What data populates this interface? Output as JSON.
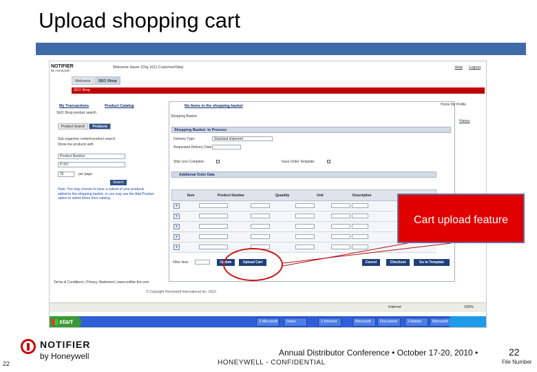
{
  "slide": {
    "title": "Upload shopping cart",
    "callout_label": "Cart upload feature",
    "accent_color": "#3e6aa8",
    "callout_color": "#e00000",
    "circle_color": "#cc1111"
  },
  "screenshot": {
    "logo": "NOTIFIER",
    "logo_sub": "By Honeywell",
    "welcome": "Welcome Haver (Org 101) Customer/Step",
    "top_links": [
      "Help",
      "Logout"
    ],
    "tabs": [
      "Welcome",
      "SEO Shop"
    ],
    "red_bar": "SEO Shop",
    "left": {
      "my_transactions": "My Transactions",
      "product_catalog": "Product Catalog",
      "breadcrumb": "SEO Shop product search",
      "subtabs": [
        "Product Search",
        "Products"
      ],
      "search_help_1": "Sub organizer content product search",
      "search_help_2": "Show me products with",
      "select_value": "Product Number",
      "input_value": "P-SH",
      "page_select": "25",
      "page_label": "per page",
      "search_button": "Search",
      "help_text": "Note: You may choose to have a subset of your products added to the shopping basket, or you may use the Add Product option to select items from catalog."
    },
    "main": {
      "no_items_link": "No Items in the shopping basket",
      "sub": "Shopping Basket",
      "home_profile": "Home  My Profile",
      "history": "History",
      "basket_header": "Shopping Basket: In Process",
      "delivery_type_label": "Delivery Type:",
      "delivery_type_value": "Standard shipment",
      "req_delivery_label": "Requested Delivery Date:",
      "ship_complete_label": "Ship Line Complete:",
      "save_template_label": "Save Order Template:",
      "additional_header": "Additional Order Data",
      "columns": [
        "Item",
        "Product Number",
        "Quantity",
        "Unit",
        "Description"
      ],
      "row_count_display": 5,
      "filter_label": "Filter lines",
      "buttons": [
        "Update",
        "Upload Cart",
        "Cancel",
        "Checkout",
        "Go to Template"
      ]
    },
    "footer_links": "Terms & Conditions | Privacy Statement | www.notifier-fire.com",
    "copyright": "© Copyright Honeywell International Inc. 2010",
    "status_zone": "Internet",
    "zoom": "100%",
    "taskbar": {
      "start": "start",
      "items": [
        "3 Microsoft",
        "Inbox",
        "2 Internet",
        "Microsoft",
        "Document",
        "2 Adobe",
        "Microsoft"
      ]
    }
  },
  "footer": {
    "brand": "NOTIFIER",
    "brand_sub": "by Honeywell",
    "slide_number_left": "22",
    "confidential": "HONEYWELL - CONFIDENTIAL",
    "conference": "Annual Distributor Conference  •  October 17-20, 2010  •",
    "slide_number_right": "22",
    "file_number": "File Number"
  }
}
